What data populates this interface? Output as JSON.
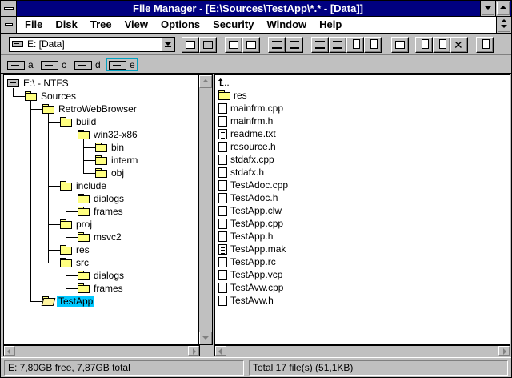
{
  "window": {
    "title": "File Manager - [E:\\Sources\\TestApp\\*.* - [Data]]"
  },
  "menu": {
    "items": [
      {
        "label": "File"
      },
      {
        "label": "Disk"
      },
      {
        "label": "Tree"
      },
      {
        "label": "View"
      },
      {
        "label": "Options"
      },
      {
        "label": "Security"
      },
      {
        "label": "Window"
      },
      {
        "label": "Help"
      }
    ]
  },
  "toolbar": {
    "drive_combo_value": "E: [Data]"
  },
  "drives": [
    {
      "letter": "a"
    },
    {
      "letter": "c"
    },
    {
      "letter": "d"
    },
    {
      "letter": "e"
    }
  ],
  "tree": {
    "items": [
      {
        "label": "E:\\ - NTFS",
        "icon": "drive-icon"
      },
      {
        "label": "Sources",
        "icon": "folder-icon"
      },
      {
        "label": "RetroWebBrowser",
        "icon": "folder-icon"
      },
      {
        "label": "build",
        "icon": "folder-icon"
      },
      {
        "label": "win32-x86",
        "icon": "folder-icon"
      },
      {
        "label": "bin",
        "icon": "folder-icon"
      },
      {
        "label": "interm",
        "icon": "folder-icon"
      },
      {
        "label": "obj",
        "icon": "folder-icon"
      },
      {
        "label": "include",
        "icon": "folder-icon"
      },
      {
        "label": "dialogs",
        "icon": "folder-icon"
      },
      {
        "label": "frames",
        "icon": "folder-icon"
      },
      {
        "label": "proj",
        "icon": "folder-icon"
      },
      {
        "label": "msvc2",
        "icon": "folder-icon"
      },
      {
        "label": "res",
        "icon": "folder-icon"
      },
      {
        "label": "src",
        "icon": "folder-icon"
      },
      {
        "label": "dialogs",
        "icon": "folder-icon"
      },
      {
        "label": "frames",
        "icon": "folder-icon"
      },
      {
        "label": "TestApp",
        "icon": "open-folder-icon",
        "selected": true
      }
    ]
  },
  "files": {
    "up_label": "..",
    "items": [
      {
        "name": "res",
        "type": "folder"
      },
      {
        "name": "mainfrm.cpp",
        "type": "doc"
      },
      {
        "name": "mainfrm.h",
        "type": "doc"
      },
      {
        "name": "readme.txt",
        "type": "text"
      },
      {
        "name": "resource.h",
        "type": "doc"
      },
      {
        "name": "stdafx.cpp",
        "type": "doc"
      },
      {
        "name": "stdafx.h",
        "type": "doc"
      },
      {
        "name": "TestAdoc.cpp",
        "type": "doc"
      },
      {
        "name": "TestAdoc.h",
        "type": "doc"
      },
      {
        "name": "TestApp.clw",
        "type": "doc"
      },
      {
        "name": "TestApp.cpp",
        "type": "doc"
      },
      {
        "name": "TestApp.h",
        "type": "doc"
      },
      {
        "name": "TestApp.mak",
        "type": "text"
      },
      {
        "name": "TestApp.rc",
        "type": "doc"
      },
      {
        "name": "TestApp.vcp",
        "type": "doc"
      },
      {
        "name": "TestAvw.cpp",
        "type": "doc"
      },
      {
        "name": "TestAvw.h",
        "type": "doc"
      }
    ]
  },
  "status": {
    "left": "E: 7,80GB free,  7,87GB total",
    "right": "Total 17 file(s) (51,1KB)"
  },
  "colors": {
    "title_bar": "#000080",
    "selection": "#00c8ff",
    "folder": "#ffff80"
  }
}
